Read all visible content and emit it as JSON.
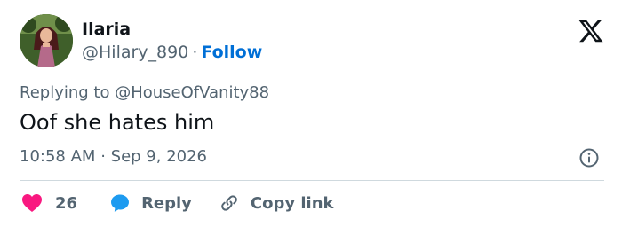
{
  "user": {
    "display_name": "Ilaria",
    "handle": "@Hilary_890",
    "separator": "·",
    "follow_label": "Follow"
  },
  "reply_context": {
    "prefix": "Replying to ",
    "mention": "@HouseOfVanity88"
  },
  "tweet": {
    "text": "Oof she hates him",
    "time": "10:58 AM",
    "separator": "·",
    "date": "Sep 9, 2026"
  },
  "actions": {
    "like_count": "26",
    "reply_label": "Reply",
    "copy_link_label": "Copy link"
  },
  "colors": {
    "like": "#f91880",
    "reply": "#1d9bf0",
    "follow": "#006fd6",
    "secondary_text": "#536471"
  },
  "icons": {
    "brand": "x-logo-icon",
    "info": "info-icon",
    "like": "heart-icon",
    "reply": "speech-bubble-icon",
    "copy_link": "link-icon"
  }
}
